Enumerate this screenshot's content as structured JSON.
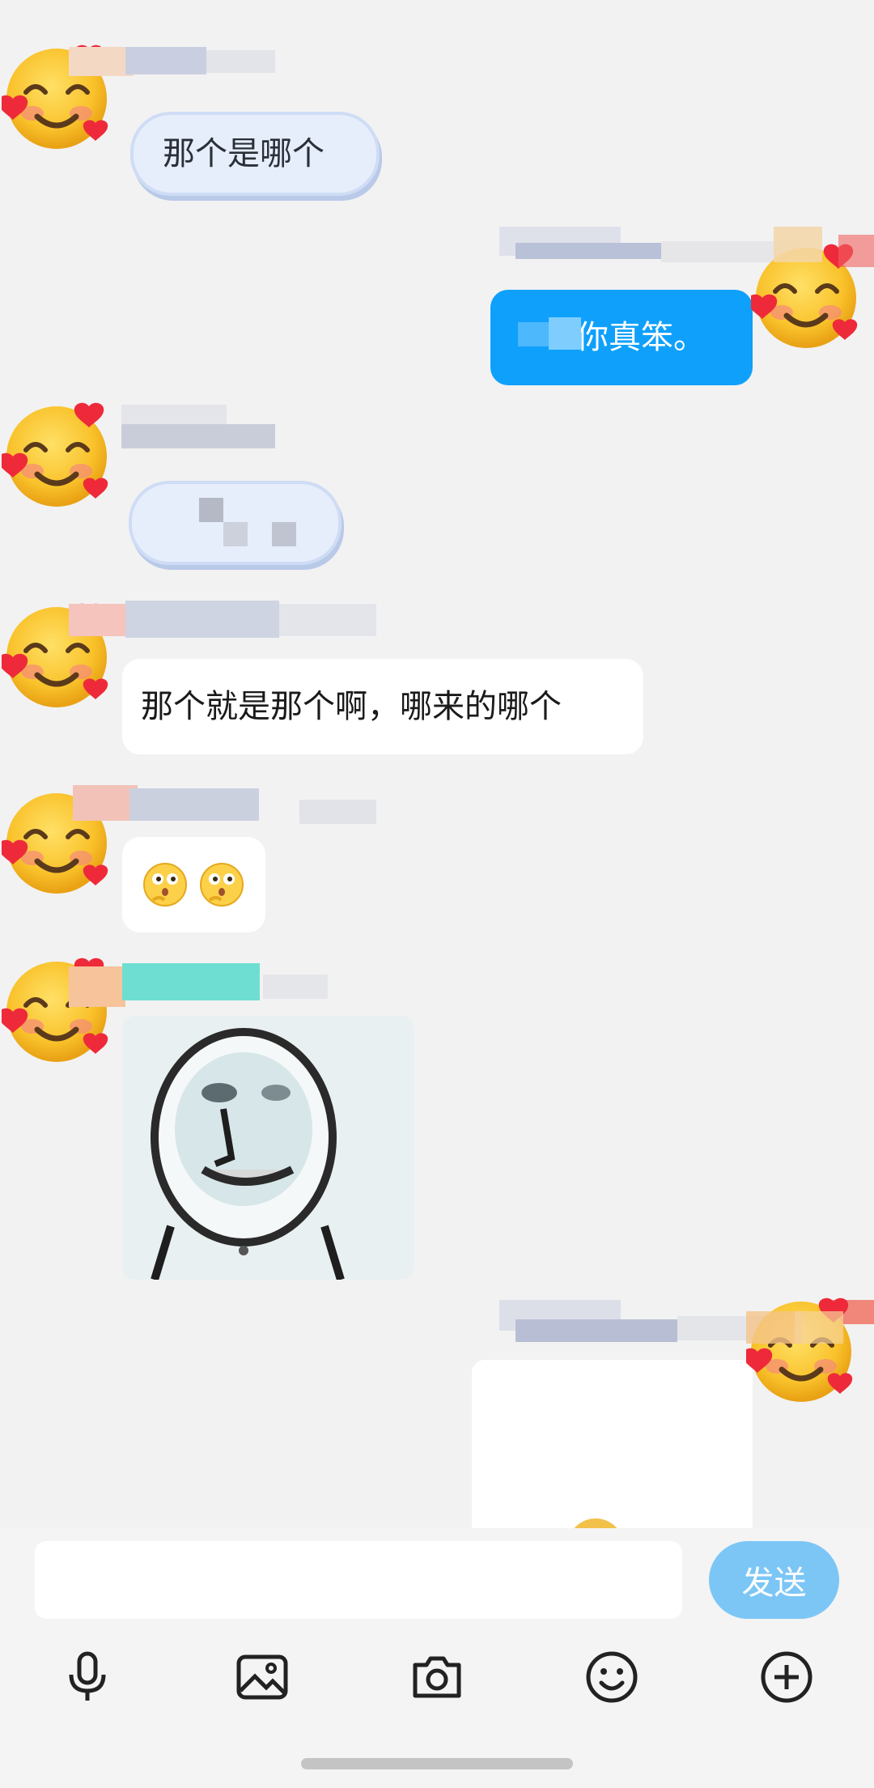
{
  "messages": [
    {
      "side": "left",
      "type": "text",
      "style": "cloud",
      "text": "那个是哪个"
    },
    {
      "side": "right",
      "type": "text",
      "style": "blue",
      "text_visible": "你真笨。"
    },
    {
      "side": "left",
      "type": "text",
      "style": "cloud",
      "text_visible": ""
    },
    {
      "side": "left",
      "type": "text",
      "style": "white",
      "text": "那个就是那个啊，哪来的哪个"
    },
    {
      "side": "left",
      "type": "emoji",
      "style": "white",
      "emoji": "🤔🤔",
      "emoji_icons": [
        "thinking-face-icon",
        "thinking-face-icon"
      ]
    },
    {
      "side": "left",
      "type": "sticker",
      "icon": "meme-face-sticker"
    },
    {
      "side": "right",
      "type": "image",
      "style": "white"
    }
  ],
  "composer": {
    "input_value": "",
    "send_label": "发送"
  },
  "toolbar": {
    "icons": [
      "microphone-icon",
      "image-icon",
      "camera-icon",
      "emoji-icon",
      "plus-icon"
    ]
  },
  "colors": {
    "background": "#f2f2f2",
    "blue_bubble": "#0fa0fb",
    "send_button": "#7cc6f6",
    "cloud_bubble": "#e6eefc"
  }
}
